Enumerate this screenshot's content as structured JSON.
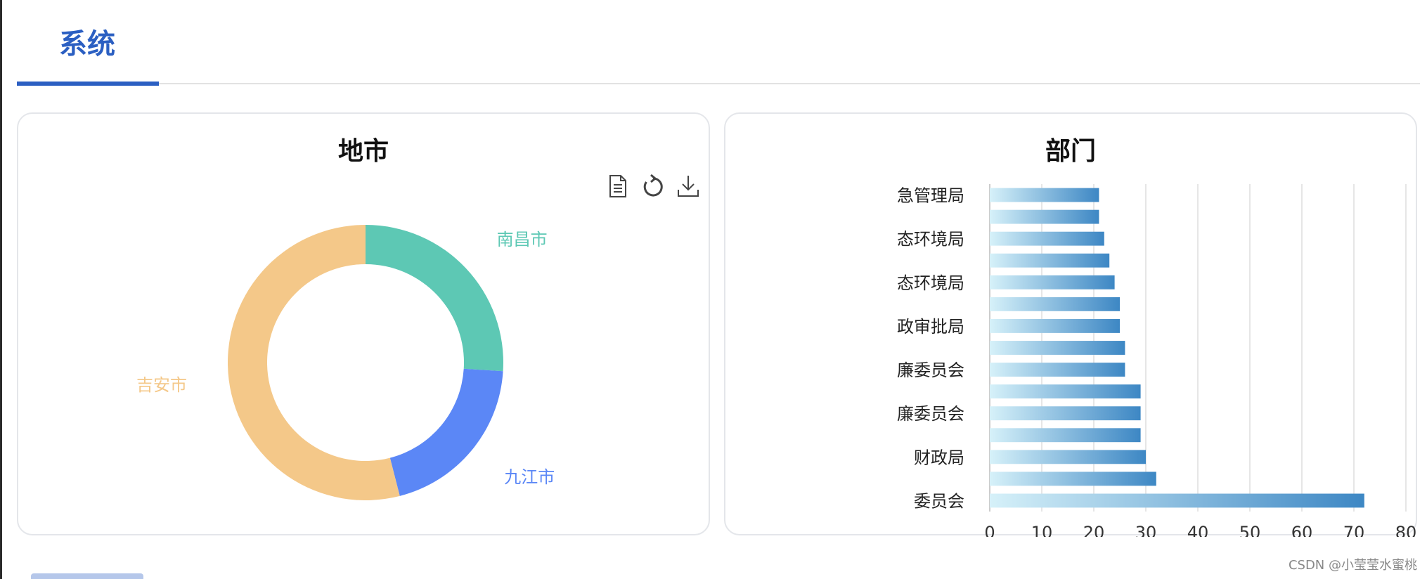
{
  "tabs": {
    "active_label": "系统"
  },
  "left_card": {
    "title": "地市",
    "toolbox": [
      "data-view-icon",
      "refresh-icon",
      "download-icon"
    ]
  },
  "right_card": {
    "title": "部门"
  },
  "footer": {
    "watermark": "CSDN @小莹莹水蜜桃"
  },
  "chart_data": [
    {
      "type": "pie",
      "style": "donut",
      "title": "地市",
      "slices": [
        {
          "name": "南昌市",
          "value": 26,
          "color": "#5dc8b4"
        },
        {
          "name": "九江市",
          "value": 20,
          "color": "#5b87f6"
        },
        {
          "name": "吉安市",
          "value": 54,
          "color": "#f4c889"
        }
      ]
    },
    {
      "type": "bar",
      "orientation": "horizontal",
      "title": "部门",
      "xlim": [
        0,
        80
      ],
      "xticks": [
        0,
        10,
        20,
        30,
        40,
        50,
        60,
        70,
        80
      ],
      "grid": true,
      "categories": [
        "急管理局",
        "",
        "态环境局",
        "",
        "态环境局",
        "",
        "政审批局",
        "",
        "廉委员会",
        "",
        "廉委员会",
        "",
        "财政局",
        "",
        "委员会"
      ],
      "values": [
        21,
        21,
        22,
        23,
        24,
        25,
        25,
        26,
        26,
        29,
        29,
        29,
        30,
        32,
        72
      ],
      "gradient": [
        "#d6f1f9",
        "#3d87c4"
      ]
    }
  ]
}
